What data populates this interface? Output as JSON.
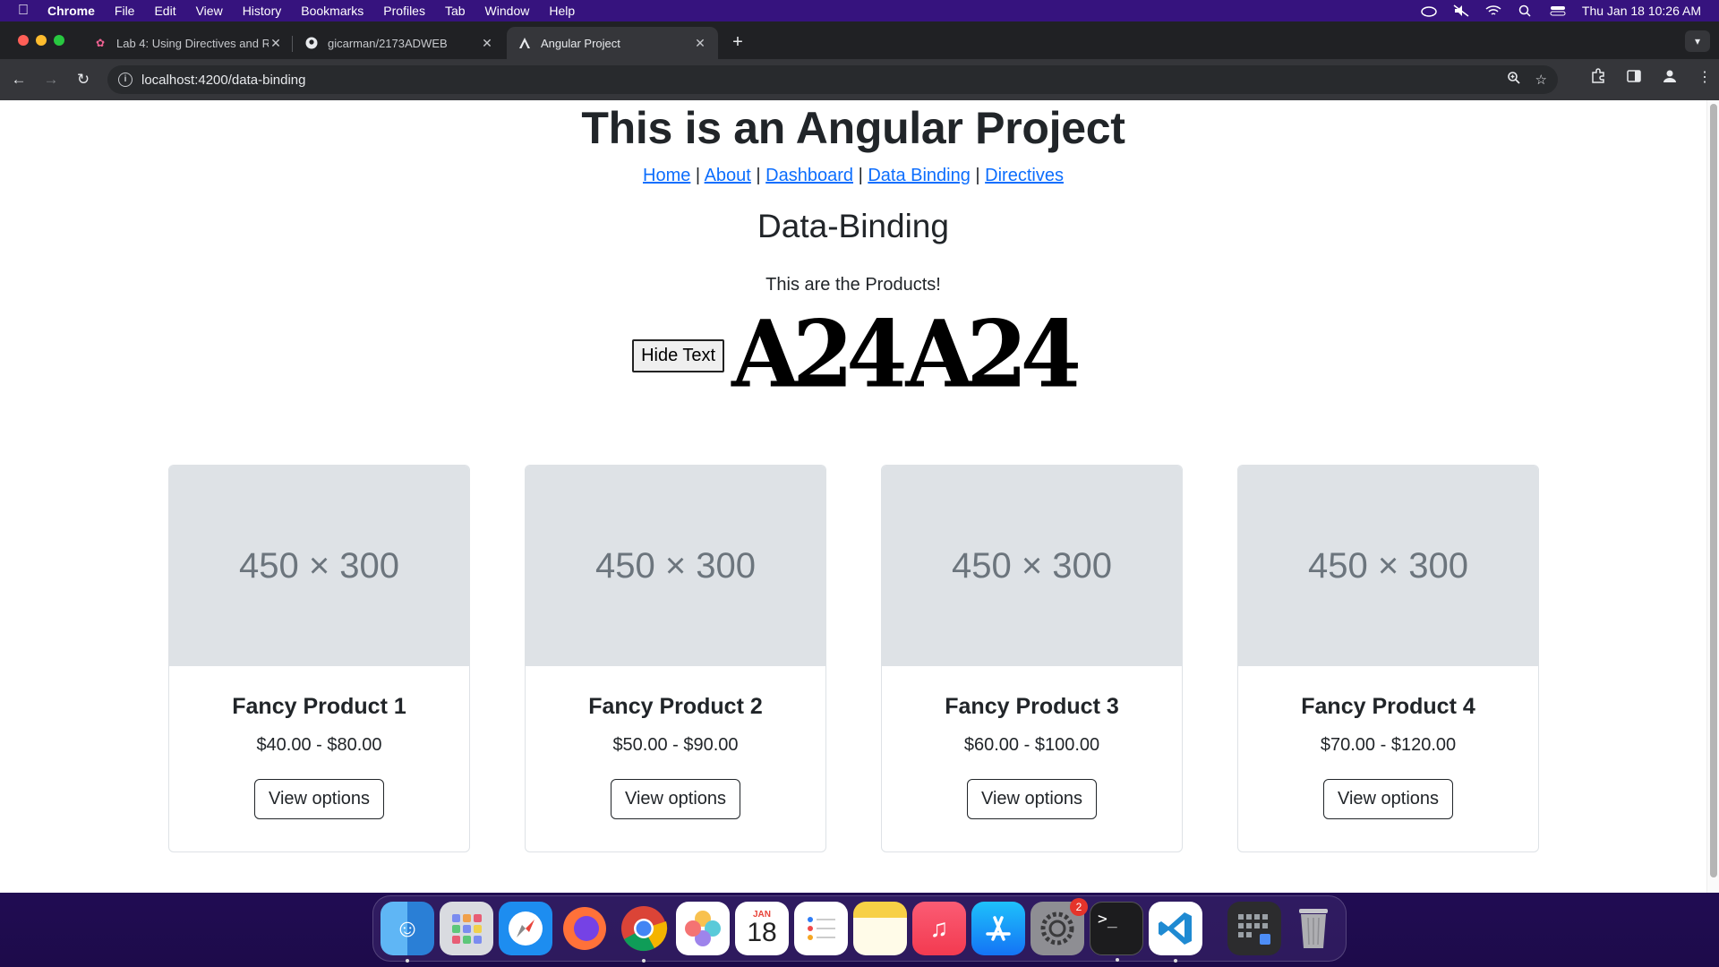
{
  "menubar": {
    "app": "Chrome",
    "items": [
      "File",
      "Edit",
      "View",
      "History",
      "Bookmarks",
      "Profiles",
      "Tab",
      "Window",
      "Help"
    ],
    "datetime": "Thu Jan 18  10:26 AM"
  },
  "tabs": [
    {
      "title": "Lab 4: Using Directives and R",
      "icon": "lab-favicon"
    },
    {
      "title": "gicarman/2173ADWEB",
      "icon": "github-icon"
    },
    {
      "title": "Angular Project",
      "icon": "angular-icon",
      "active": true
    }
  ],
  "address": {
    "url": "localhost:4200/data-binding"
  },
  "page": {
    "title": "This is an Angular Project",
    "nav": [
      "Home",
      "About",
      "Dashboard",
      "Data Binding",
      "Directives"
    ],
    "nav_sep": "|",
    "heading": "Data-Binding",
    "tagline": "This are the Products!",
    "hide_button": "Hide Text",
    "logo_text": "A24",
    "products": [
      {
        "image": "450 × 300",
        "name": "Fancy Product 1",
        "price": "$40.00 - $80.00",
        "button": "View options"
      },
      {
        "image": "450 × 300",
        "name": "Fancy Product 2",
        "price": "$50.00 - $90.00",
        "button": "View options"
      },
      {
        "image": "450 × 300",
        "name": "Fancy Product 3",
        "price": "$60.00 - $100.00",
        "button": "View options"
      },
      {
        "image": "450 × 300",
        "name": "Fancy Product 4",
        "price": "$70.00 - $120.00",
        "button": "View options"
      }
    ]
  },
  "dock": {
    "calendar_month": "JAN",
    "calendar_day": "18",
    "settings_badge": "2"
  },
  "colors": {
    "link": "#0d6efd",
    "placeholder_bg": "#dee2e6",
    "menubar_bg": "#36137e"
  }
}
